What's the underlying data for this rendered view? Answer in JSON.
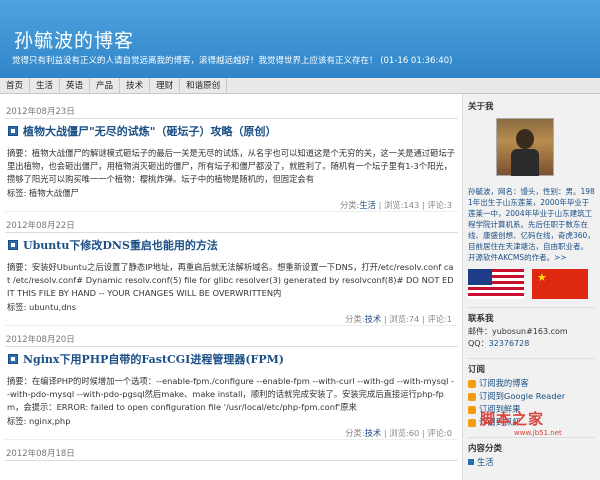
{
  "header": {
    "title": "孙毓波的博客",
    "motto": "觉得只有利益没有正义的人请自觉远离我的博客，滚得越远越好！我觉得世界上应该有正义存在！  (01-16 01:36:40)"
  },
  "nav": [
    "首页",
    "生活",
    "英语",
    "产品",
    "技术",
    "理财",
    "和谐原创"
  ],
  "posts": [
    {
      "date": "2012年08月23日",
      "title": "植物大战僵尸\"无尽的试炼\"（砸坛子）攻略（原创）",
      "summary": "摘要：植物大战僵尸的解谜模式砸坛子的最后一关是无尽的试炼，从名字也可以知道这是个无穷的关，这一关是通过砸坛子里出植物，也会砸出僵尸，用植物消灭砸出的僵尸，所有坛子和僵尸都没了，就胜利了。随机有一个坛子里有1-3个阳光，攒够了阳光可以购买唯一一个植物：樱桃炸弹。坛子中的植物是随机的，但固定会有",
      "tags": "标签: 植物大战僵尸",
      "category_label": "分类:",
      "category": "生活",
      "stats": "| 浏览:143 | 评论:3"
    },
    {
      "date": "2012年08月22日",
      "title": "Ubuntu下修改DNS重启也能用的方法",
      "summary": "摘要：安装好Ubuntu之后设置了静态IP地址，再重启后就无法解析域名。想重新设置一下DNS，打开/etc/resolv.conf cat /etc/resolv.conf# Dynamic resolv.conf(5) file for glibc resolver(3) generated by resolvconf(8)#     DO NOT EDIT THIS FILE BY HAND -- YOUR CHANGES WILL BE OVERWRITTEN内",
      "tags": "标签: ubuntu,dns",
      "category_label": "分类:",
      "category": "技术",
      "stats": "| 浏览:74 | 评论:1"
    },
    {
      "date": "2012年08月20日",
      "title": "Nginx下用PHP自带的FastCGI进程管理器(FPM)",
      "summary": "摘要：在编译PHP的时候增加一个选项：--enable-fpm./configure --enable-fpm --with-curl --with-gd --with-mysql --with-pdo-mysql --with-pdo-pgsql然后make、make install，顺利的话就完成安装了。安装完成后直接运行php-fpm，会提示：ERROR: failed to open configuration file '/usr/local/etc/php-fpm.conf'原来",
      "tags": "标签: nginx,php",
      "category_label": "分类:",
      "category": "技术",
      "stats": "| 浏览:60 | 评论:0"
    },
    {
      "date": "2012年08月18日",
      "title": "",
      "summary": "",
      "tags": "",
      "category_label": "",
      "category": "",
      "stats": ""
    }
  ],
  "sidebar": {
    "about_title": "关于我",
    "about_text": "孙毓波，网名：馒头，性别：男。1981年出生于山东莲莱，2000年毕业于莲莱一中，2004年毕业于山东建筑工程学院计算机系。先后任职于数东在线、康盛创想、亿码在线，奇虎360，目前居住在天津塘沽，自由职业者。开源软件AKCMS的作者。>>",
    "contact_title": "联系我",
    "email_label": "邮件：",
    "email": "yubosun#163.com",
    "qq_label": "QQ：",
    "qq": "32376728",
    "subscribe_title": "订阅",
    "subscribe_items": [
      "订阅我的博客",
      "订阅到Google Reader",
      "订阅到鲜果",
      "订阅到抓虾"
    ],
    "categories_title": "内容分类",
    "categories": [
      "生活"
    ]
  },
  "watermark": {
    "main": "脚本之家",
    "sub": "www.jb51.net"
  }
}
